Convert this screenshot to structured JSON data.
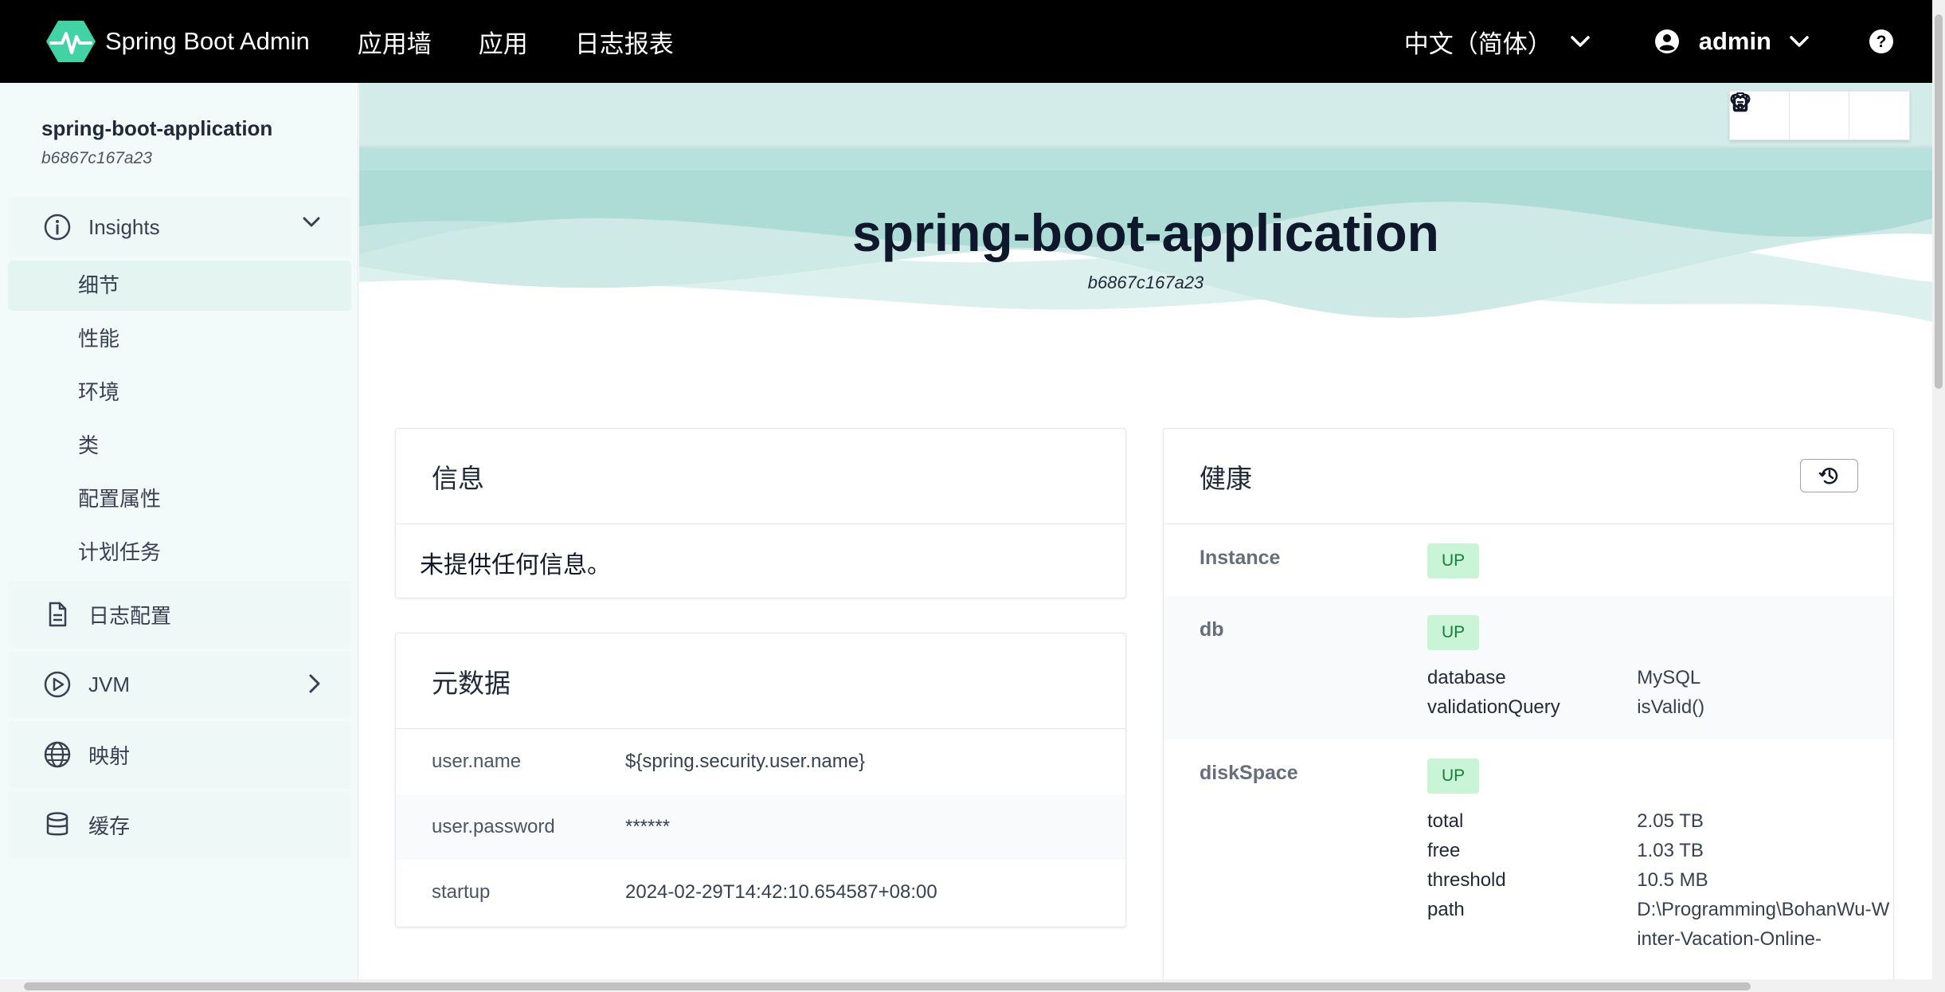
{
  "navbar": {
    "brand": "Spring Boot Admin",
    "links": [
      "应用墙",
      "应用",
      "日志报表"
    ],
    "language": "中文（简体）",
    "user": "admin"
  },
  "sidebar": {
    "app_name": "spring-boot-application",
    "app_id": "b6867c167a23",
    "insights_label": "Insights",
    "insights_items": [
      "细节",
      "性能",
      "环境",
      "类",
      "配置属性",
      "计划任务"
    ],
    "items": [
      {
        "label": "日志配置",
        "icon": "file-icon"
      },
      {
        "label": "JVM",
        "icon": "play-circle-icon"
      },
      {
        "label": "映射",
        "icon": "globe-icon"
      },
      {
        "label": "缓存",
        "icon": "database-icon"
      }
    ]
  },
  "hero": {
    "title": "spring-boot-application",
    "subtitle": "b6867c167a23"
  },
  "info_card": {
    "title": "信息",
    "empty_text": "未提供任何信息。"
  },
  "metadata_card": {
    "title": "元数据",
    "rows": [
      {
        "key": "user.name",
        "value": "${spring.security.user.name}"
      },
      {
        "key": "user.password",
        "value": "******"
      },
      {
        "key": "startup",
        "value": "2024-02-29T14:42:10.654587+08:00"
      }
    ]
  },
  "health_card": {
    "title": "健康",
    "components": [
      {
        "name": "Instance",
        "status": "UP",
        "details": []
      },
      {
        "name": "db",
        "status": "UP",
        "details": [
          {
            "key": "database",
            "value": "MySQL"
          },
          {
            "key": "validationQuery",
            "value": "isValid()"
          }
        ]
      },
      {
        "name": "diskSpace",
        "status": "UP",
        "details": [
          {
            "key": "total",
            "value": "2.05 TB"
          },
          {
            "key": "free",
            "value": "1.03 TB"
          },
          {
            "key": "threshold",
            "value": "10.5 MB"
          },
          {
            "key": "path",
            "value": "D:\\Programming\\BohanWu-Winter-Vacation-Online-"
          }
        ]
      }
    ]
  },
  "colors": {
    "navbar_bg": "#000000",
    "accent": "#42d3a5",
    "status_up_bg": "#c9f5d6",
    "status_up_text": "#15803d"
  }
}
